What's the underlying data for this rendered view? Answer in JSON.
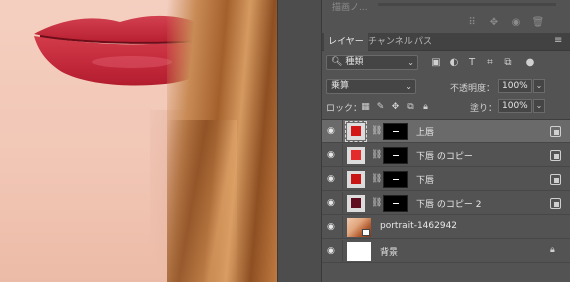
{
  "top_panel": {
    "ghost_label": "描画ノ..."
  },
  "tabs": [
    {
      "label": "レイヤー",
      "active": true
    },
    {
      "label": "チャンネル",
      "active": false
    },
    {
      "label": "パス",
      "active": false
    }
  ],
  "filter": {
    "kind_label": "種類",
    "search_icon": "search-icon"
  },
  "blend": {
    "mode": "乗算",
    "opacity_label": "不透明度：",
    "opacity_value": "100%"
  },
  "lock": {
    "label": "ロック：",
    "fill_label": "塗り：",
    "fill_value": "100%"
  },
  "layers": [
    {
      "name": "上唇",
      "color": "#d31616",
      "selected": true
    },
    {
      "name": "下唇 のコピー",
      "color": "#e42a2a",
      "selected": false
    },
    {
      "name": "下唇",
      "color": "#c91414",
      "selected": false
    },
    {
      "name": "下唇 のコピー 2",
      "color": "#5e0c1e",
      "selected": false
    },
    {
      "name": "portrait-1462942",
      "type": "smart-object"
    },
    {
      "name": "背景",
      "type": "background",
      "locked": true
    }
  ],
  "colors": {
    "panel_bg": "#535353",
    "tab_bar_bg": "#424242",
    "selected_row": "#6a6a6a"
  }
}
